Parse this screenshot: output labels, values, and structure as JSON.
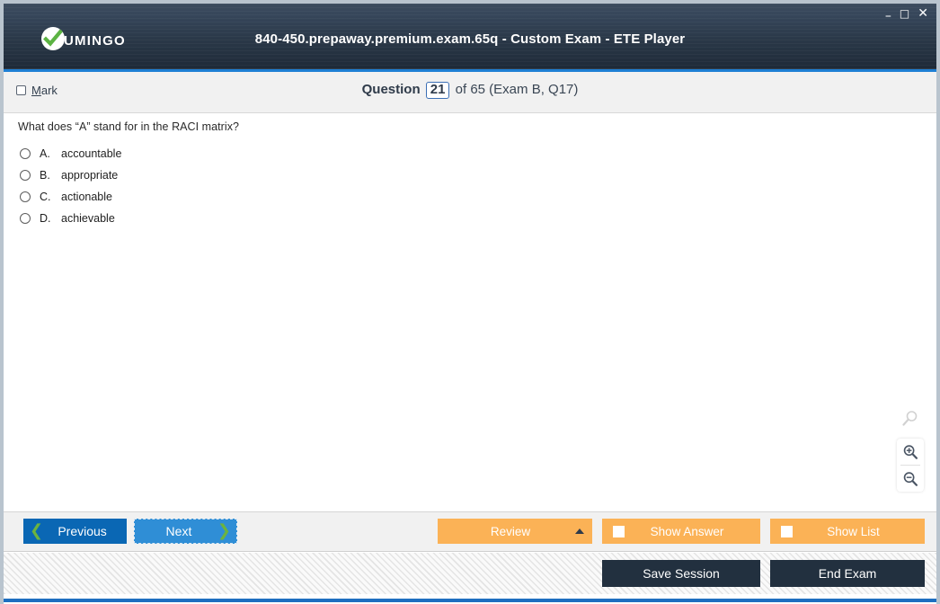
{
  "window": {
    "title": "840-450.prepaway.premium.exam.65q - Custom Exam - ETE Player",
    "logo_text": "UMINGO",
    "logo_icon": "check-circle-icon",
    "controls": {
      "minimize": "–",
      "maximize": "□",
      "close": "✕"
    },
    "accent_color": "#1e7fd4",
    "titlebar_color": "#2a3848"
  },
  "header": {
    "mark_label_accel": "M",
    "mark_label_rest": "ark",
    "mark_checked": false,
    "question_word": "Question",
    "question_number": "21",
    "question_rest": "of 65 (Exam B, Q17)"
  },
  "question": {
    "text": "What does “A” stand for in the RACI matrix?",
    "options": [
      {
        "letter": "A.",
        "text": "accountable",
        "selected": false
      },
      {
        "letter": "B.",
        "text": "appropriate",
        "selected": false
      },
      {
        "letter": "C.",
        "text": "actionable",
        "selected": false
      },
      {
        "letter": "D.",
        "text": "achievable",
        "selected": false
      }
    ]
  },
  "zoom_tools": {
    "search_icon": "magnifier-icon",
    "zoom_in_icon": "zoom-in-icon",
    "zoom_out_icon": "zoom-out-icon"
  },
  "buttons": {
    "previous": "Previous",
    "next": "Next",
    "review": "Review",
    "show_answer": "Show Answer",
    "show_list": "Show List",
    "save_session": "Save Session",
    "end_exam": "End Exam"
  },
  "colors": {
    "previous_bg": "#0a67b4",
    "next_bg": "#2f8ed6",
    "orange_bg": "#fbb256",
    "dark_bg": "#22303f",
    "chevron_green": "#6cb33f"
  }
}
